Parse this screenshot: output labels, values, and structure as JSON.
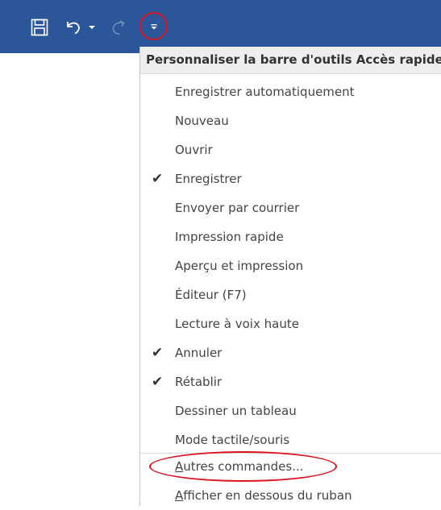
{
  "toolbar": {
    "icons": {
      "save": "save-icon",
      "undo": "undo-icon",
      "undo_dropdown": "chevron-down-icon",
      "redo": "redo-icon",
      "customize": "customize-dropdown-icon"
    },
    "colors": {
      "background": "#2b579a",
      "icon": "#ffffff",
      "disabled_icon": "#6f8dbc",
      "highlight": "#d9141f"
    }
  },
  "menu": {
    "title": "Personnaliser la barre d'outils Accès rapide",
    "items": [
      {
        "label": "Enregistrer automatiquement",
        "checked": false
      },
      {
        "label": "Nouveau",
        "checked": false
      },
      {
        "label": "Ouvrir",
        "checked": false
      },
      {
        "label": "Enregistrer",
        "checked": true
      },
      {
        "label": "Envoyer par courrier",
        "checked": false
      },
      {
        "label": "Impression rapide",
        "checked": false
      },
      {
        "label": "Aperçu et impression",
        "checked": false
      },
      {
        "label": "Éditeur (F7)",
        "checked": false
      },
      {
        "label": "Lecture à voix haute",
        "checked": false
      },
      {
        "label": "Annuler",
        "checked": true
      },
      {
        "label": "Rétablir",
        "checked": true
      },
      {
        "label": "Dessiner un tableau",
        "checked": false
      },
      {
        "label": "Mode tactile/souris",
        "checked": false
      }
    ],
    "more_commands": {
      "accel": "A",
      "rest": "utres commandes..."
    },
    "show_below": {
      "accel": "A",
      "rest": "fficher en dessous du ruban"
    },
    "check_glyph": "✔"
  }
}
